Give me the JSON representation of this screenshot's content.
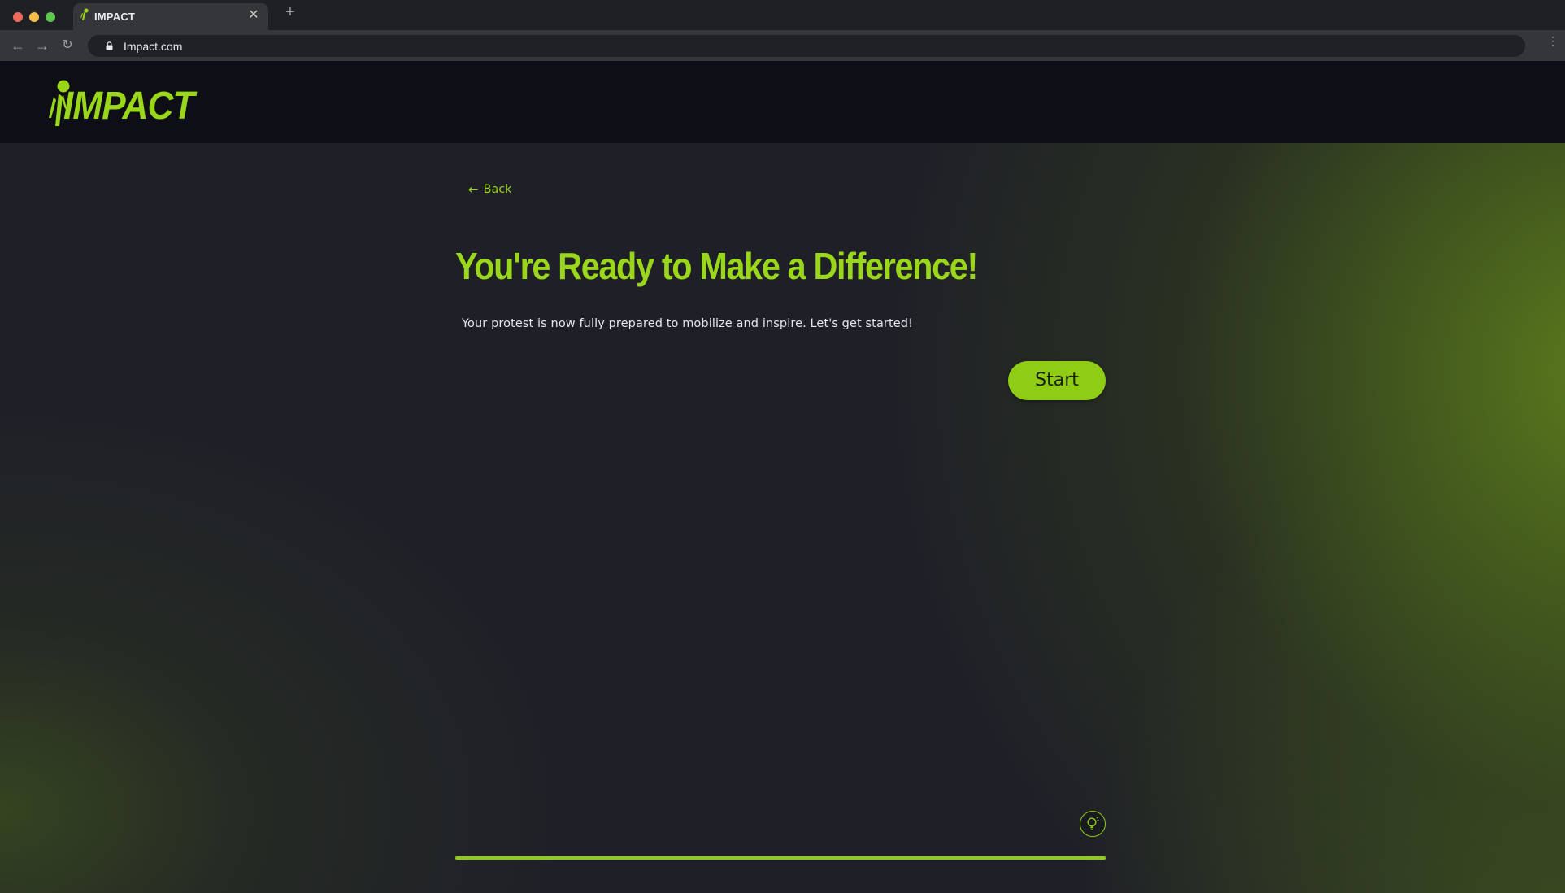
{
  "browser": {
    "tab_title": "IMPACT",
    "tab_close_icon": "close-icon",
    "new_tab_icon": "plus-icon",
    "url": "Impact.com",
    "nav": {
      "back_icon": "arrow-left-icon",
      "forward_icon": "arrow-right-icon",
      "reload_icon": "reload-icon"
    }
  },
  "header": {
    "logo_text": "IMPACT"
  },
  "main": {
    "back_label": "Back",
    "headline": "You're Ready to Make a Difference!",
    "subtext": "Your protest is now fully prepared to mobilize and inspire. Let's get started!",
    "start_label": "Start",
    "hint_icon": "lightbulb-icon",
    "progress": 1.0
  },
  "colors": {
    "accent": "#8fcc16",
    "header_bg": "#0e0e17",
    "page_bg": "#1f2027"
  }
}
